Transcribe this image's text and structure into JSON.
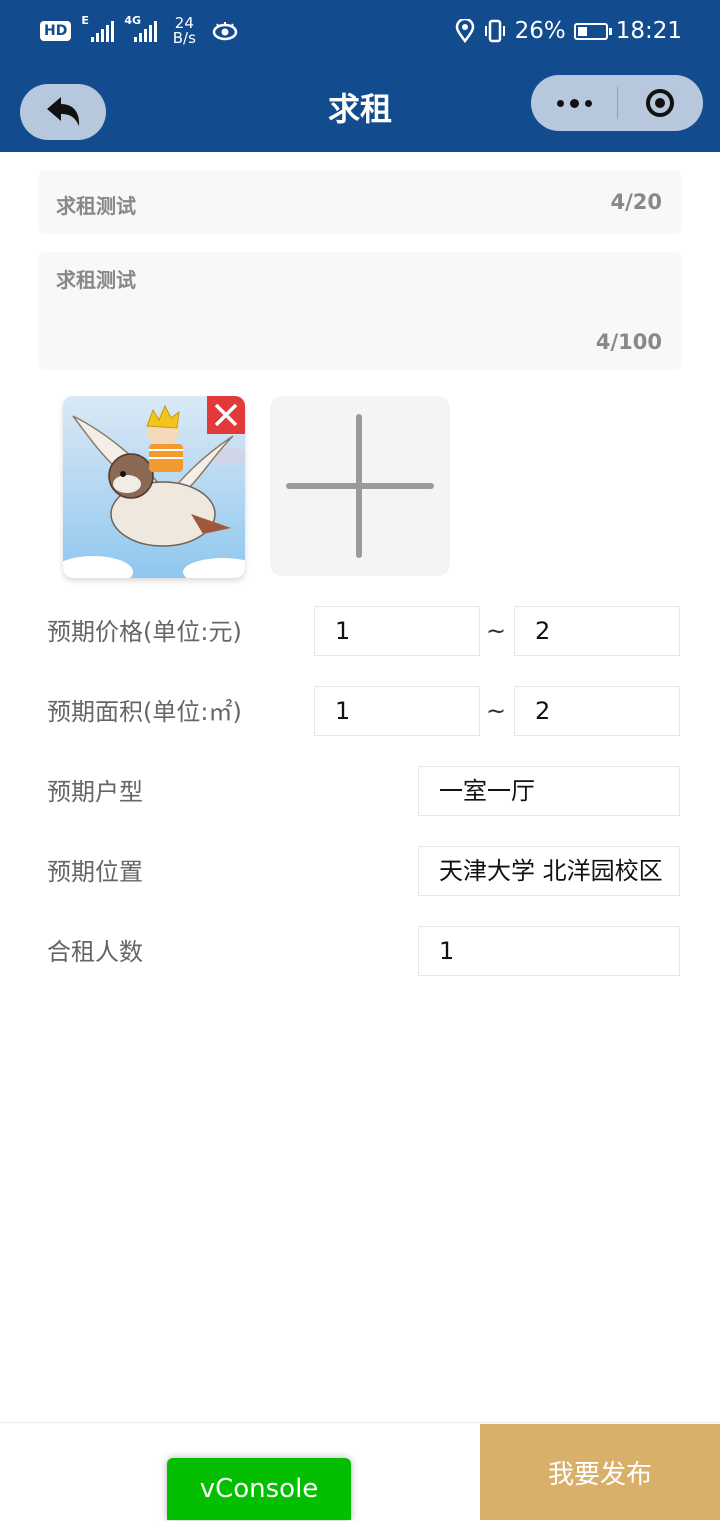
{
  "status_bar": {
    "hd_badge": "HD",
    "net1": "E",
    "net2": "4G",
    "speed_value": "24",
    "speed_unit": "B/s",
    "battery": "26%",
    "time": "18:21"
  },
  "header": {
    "title": "求租"
  },
  "form": {
    "title_value": "求租测试",
    "title_count": "4/20",
    "desc_value": "求租测试",
    "desc_count": "4/100"
  },
  "fields": {
    "price": {
      "label": "预期价格(单位:元)",
      "min": "1",
      "sep": "~",
      "max": "2"
    },
    "area": {
      "label": "预期面积(单位:㎡)",
      "min": "1",
      "sep": "~",
      "max": "2"
    },
    "layout": {
      "label": "预期户型",
      "value": "一室一厅"
    },
    "location": {
      "label": "预期位置",
      "value": "天津大学 北洋园校区"
    },
    "people": {
      "label": "合租人数",
      "value": "1"
    }
  },
  "bottom": {
    "publish": "我要发布",
    "vconsole": "vConsole"
  },
  "colors": {
    "header_bg": "#124c8e",
    "publish_bg": "#d9b06a",
    "vconsole_bg": "#04be02",
    "delete_red": "#e03a3a"
  }
}
